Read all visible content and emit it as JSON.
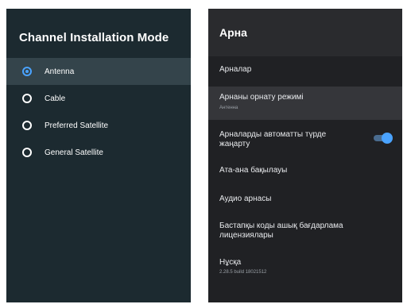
{
  "left_panel": {
    "title": "Channel Installation Mode",
    "options": [
      {
        "label": "Antenna",
        "selected": true
      },
      {
        "label": "Cable",
        "selected": false
      },
      {
        "label": "Preferred Satellite",
        "selected": false
      },
      {
        "label": "General Satellite",
        "selected": false
      }
    ]
  },
  "right_panel": {
    "title": "Арна",
    "items": [
      {
        "label": "Арналар"
      },
      {
        "label": "Арнаны орнату режимі",
        "value": "Антенна"
      },
      {
        "label": "Арналарды автоматты түрде жаңарту",
        "toggle": true
      },
      {
        "label": "Ата-ана бақылауы"
      },
      {
        "label": "Аудио арнасы"
      },
      {
        "label": "Бастапқы коды ашық бағдарлама лицензиялары"
      },
      {
        "label": "Нұсқа",
        "value": "2.28.5 build 18021512"
      }
    ]
  },
  "colors": {
    "left_background": "#1c2a30",
    "right_background": "#202124",
    "accent": "#4aa3ff"
  }
}
